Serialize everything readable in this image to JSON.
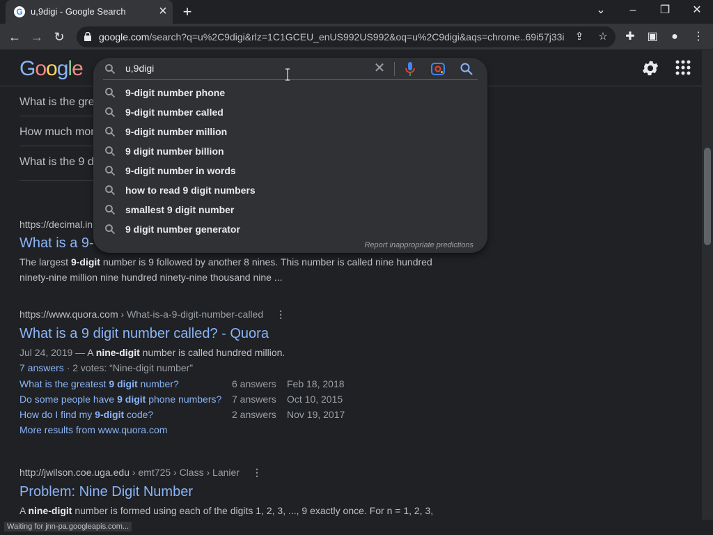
{
  "browser": {
    "tab_title": "u,9digi - Google Search",
    "url_host": "google.com",
    "url_path": "/search?q=u%2C9digi&rlz=1C1GCEU_enUS992US992&oq=u%2C9digi&aqs=chrome..69i57j33i..."
  },
  "header": {
    "logo_parts": [
      "G",
      "o",
      "o",
      "g",
      "l",
      "e"
    ]
  },
  "paa": [
    "What is the gre",
    "How much mor",
    "What is the 9 d"
  ],
  "result1": {
    "cite": "https://decimal.in",
    "title": "What is a 9-",
    "snippet_pre": "The largest ",
    "snippet_bold": "9-digit",
    "snippet_post": " number is 9 followed by another 8 nines. This number is called nine hundred ninety-nine million nine hundred ninety-nine thousand nine ..."
  },
  "result2": {
    "cite_host": "https://www.quora.com",
    "cite_path": " › What-is-a-9-digit-number-called",
    "title": "What is a 9 digit number called? - Quora",
    "date": "Jul 24, 2019 — ",
    "snippet_pre": "A ",
    "snippet_bold": "nine-digit",
    "snippet_post": " number is called hundred million.",
    "answers_link": "7 answers",
    "votes": " · 2 votes: “Nine-digit number”",
    "sub": [
      {
        "pre": "What is the greatest ",
        "bold": "9 digit",
        "post": " number?",
        "answers": "6 answers",
        "date": "Feb 18, 2018"
      },
      {
        "pre": "Do some people have ",
        "bold": "9 digit",
        "post": " phone numbers?",
        "answers": "7 answers",
        "date": "Oct 10, 2015"
      },
      {
        "pre": "How do I find my ",
        "bold": "9-digit",
        "post": " code?",
        "answers": "2 answers",
        "date": "Nov 19, 2017"
      }
    ],
    "more": "More results from www.quora.com"
  },
  "result3": {
    "cite_host": "http://jwilson.coe.uga.edu",
    "cite_path": " › emt725 › Class › Lanier",
    "title": "Problem: Nine Digit Number",
    "snippet_pre": "A ",
    "snippet_bold": "nine-digit",
    "snippet_post": " number is formed using each of the digits 1, 2, 3, ..., 9 exactly once. For n = 1, 2, 3,"
  },
  "autocomplete": {
    "query": "u,9digi",
    "suggestions": [
      "9-digit number phone",
      "9-digit number called",
      "9-digit number million",
      "9 digit number billion",
      "9-digit number in words",
      "how to read 9 digit numbers",
      "smallest 9 digit number",
      "9 digit number generator"
    ],
    "report": "Report inappropriate predictions"
  },
  "status": "Waiting for jnn-pa.googleapis.com...",
  "colors": {
    "background": "#202124",
    "link": "#8ab4f8",
    "dropdown": "#303134"
  }
}
